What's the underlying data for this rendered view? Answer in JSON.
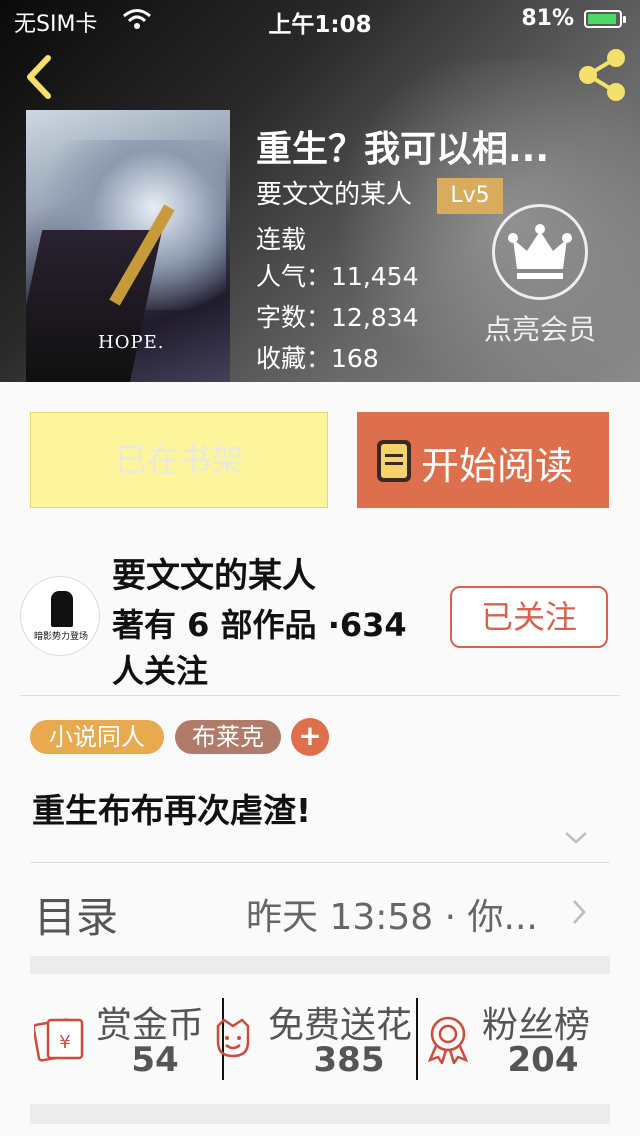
{
  "status_bar": {
    "carrier": "无SIM卡",
    "time": "上午1:08",
    "battery": "81%"
  },
  "book": {
    "title": "重生？我可以相...",
    "author": "要文文的某人",
    "level": "Lv5",
    "status": "连载",
    "popularity_label": "人气：",
    "popularity": "11,454",
    "words_label": "字数：",
    "words": "12,834",
    "favorites_label": "收藏：",
    "favorites": "168",
    "cover_text": "HOPE."
  },
  "vip": {
    "label": "点亮会员"
  },
  "actions": {
    "shelf_label": "已在书架",
    "read_label": "开始阅读"
  },
  "author_card": {
    "name": "要文文的某人",
    "works": "著有 6 部作品 ·634 人关注",
    "follow_label": "已关注",
    "avatar_text": "暗影势力登场"
  },
  "tags": [
    {
      "label": "小说同人",
      "color": "#e9a94e"
    },
    {
      "label": "布莱克",
      "color": "#b07b69"
    }
  ],
  "summary": "重生布布再次虐渣!",
  "toc": {
    "label": "目录",
    "update": "昨天 13:58 · 你..."
  },
  "stats": [
    {
      "label": "赏金币",
      "value": "54",
      "icon": "red-envelope-icon"
    },
    {
      "label": "免费送花",
      "value": "385",
      "icon": "flower-icon"
    },
    {
      "label": "粉丝榜",
      "value": "204",
      "icon": "medal-icon"
    }
  ],
  "colors": {
    "accent": "#dd6f4c",
    "shelf_bg": "#fdf59b",
    "gold": "#d8ac5c",
    "share": "#f4e06a"
  }
}
